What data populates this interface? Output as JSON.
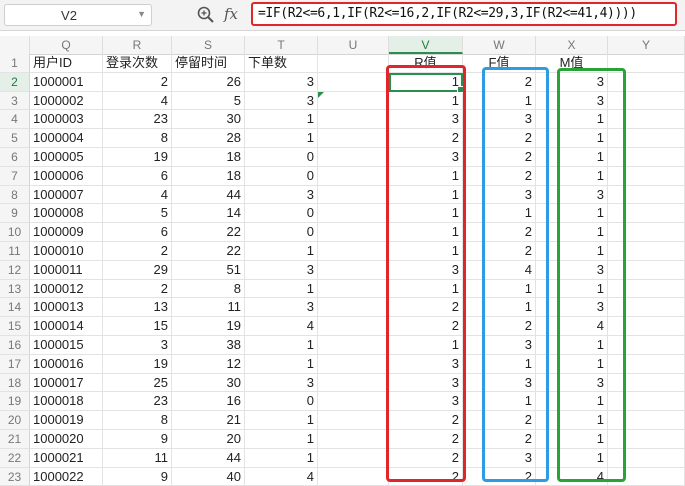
{
  "formula_bar": {
    "namebox": "V2",
    "formula": "=IF(R2<=6,1,IF(R2<=16,2,IF(R2<=29,3,IF(R2<=41,4))))"
  },
  "columns": [
    "Q",
    "R",
    "S",
    "T",
    "U",
    "V",
    "W",
    "X",
    "Y"
  ],
  "header_row": {
    "row_number": "1",
    "cells": [
      "用户ID",
      "登录次数",
      "停留时间",
      "下单数",
      "",
      "R值",
      "F值",
      "M值",
      ""
    ]
  },
  "rows": [
    {
      "n": "2",
      "id": "1000001",
      "login": "2",
      "stay": "26",
      "orders": "3",
      "r": "1",
      "f": "2",
      "m": "3"
    },
    {
      "n": "3",
      "id": "1000002",
      "login": "4",
      "stay": "5",
      "orders": "3",
      "r": "1",
      "f": "1",
      "m": "3"
    },
    {
      "n": "4",
      "id": "1000003",
      "login": "23",
      "stay": "30",
      "orders": "1",
      "r": "3",
      "f": "3",
      "m": "1"
    },
    {
      "n": "5",
      "id": "1000004",
      "login": "8",
      "stay": "28",
      "orders": "1",
      "r": "2",
      "f": "2",
      "m": "1"
    },
    {
      "n": "6",
      "id": "1000005",
      "login": "19",
      "stay": "18",
      "orders": "0",
      "r": "3",
      "f": "2",
      "m": "1"
    },
    {
      "n": "7",
      "id": "1000006",
      "login": "6",
      "stay": "18",
      "orders": "0",
      "r": "1",
      "f": "2",
      "m": "1"
    },
    {
      "n": "8",
      "id": "1000007",
      "login": "4",
      "stay": "44",
      "orders": "3",
      "r": "1",
      "f": "3",
      "m": "3"
    },
    {
      "n": "9",
      "id": "1000008",
      "login": "5",
      "stay": "14",
      "orders": "0",
      "r": "1",
      "f": "1",
      "m": "1"
    },
    {
      "n": "10",
      "id": "1000009",
      "login": "6",
      "stay": "22",
      "orders": "0",
      "r": "1",
      "f": "2",
      "m": "1"
    },
    {
      "n": "11",
      "id": "1000010",
      "login": "2",
      "stay": "22",
      "orders": "1",
      "r": "1",
      "f": "2",
      "m": "1"
    },
    {
      "n": "12",
      "id": "1000011",
      "login": "29",
      "stay": "51",
      "orders": "3",
      "r": "3",
      "f": "4",
      "m": "3"
    },
    {
      "n": "13",
      "id": "1000012",
      "login": "2",
      "stay": "8",
      "orders": "1",
      "r": "1",
      "f": "1",
      "m": "1"
    },
    {
      "n": "14",
      "id": "1000013",
      "login": "13",
      "stay": "11",
      "orders": "3",
      "r": "2",
      "f": "1",
      "m": "3"
    },
    {
      "n": "15",
      "id": "1000014",
      "login": "15",
      "stay": "19",
      "orders": "4",
      "r": "2",
      "f": "2",
      "m": "4"
    },
    {
      "n": "16",
      "id": "1000015",
      "login": "3",
      "stay": "38",
      "orders": "1",
      "r": "1",
      "f": "3",
      "m": "1"
    },
    {
      "n": "17",
      "id": "1000016",
      "login": "19",
      "stay": "12",
      "orders": "1",
      "r": "3",
      "f": "1",
      "m": "1"
    },
    {
      "n": "18",
      "id": "1000017",
      "login": "25",
      "stay": "30",
      "orders": "3",
      "r": "3",
      "f": "3",
      "m": "3"
    },
    {
      "n": "19",
      "id": "1000018",
      "login": "23",
      "stay": "16",
      "orders": "0",
      "r": "3",
      "f": "1",
      "m": "1"
    },
    {
      "n": "20",
      "id": "1000019",
      "login": "8",
      "stay": "21",
      "orders": "1",
      "r": "2",
      "f": "2",
      "m": "1"
    },
    {
      "n": "21",
      "id": "1000020",
      "login": "9",
      "stay": "20",
      "orders": "1",
      "r": "2",
      "f": "2",
      "m": "1"
    },
    {
      "n": "22",
      "id": "1000021",
      "login": "11",
      "stay": "44",
      "orders": "1",
      "r": "2",
      "f": "3",
      "m": "1"
    },
    {
      "n": "23",
      "id": "1000022",
      "login": "9",
      "stay": "40",
      "orders": "4",
      "r": "2",
      "f": "2",
      "m": "4"
    }
  ],
  "colors": {
    "r_highlight": "#e0262a",
    "f_highlight": "#2f9be3",
    "m_highlight": "#28a338",
    "selection": "#2a8f4e",
    "formula_highlight": "#e0262a"
  },
  "icons": {
    "zoom": "magnifier-zoom-icon",
    "fx": "fx-icon",
    "dropdown": "chevron-down-icon"
  },
  "fx_label": "fx"
}
